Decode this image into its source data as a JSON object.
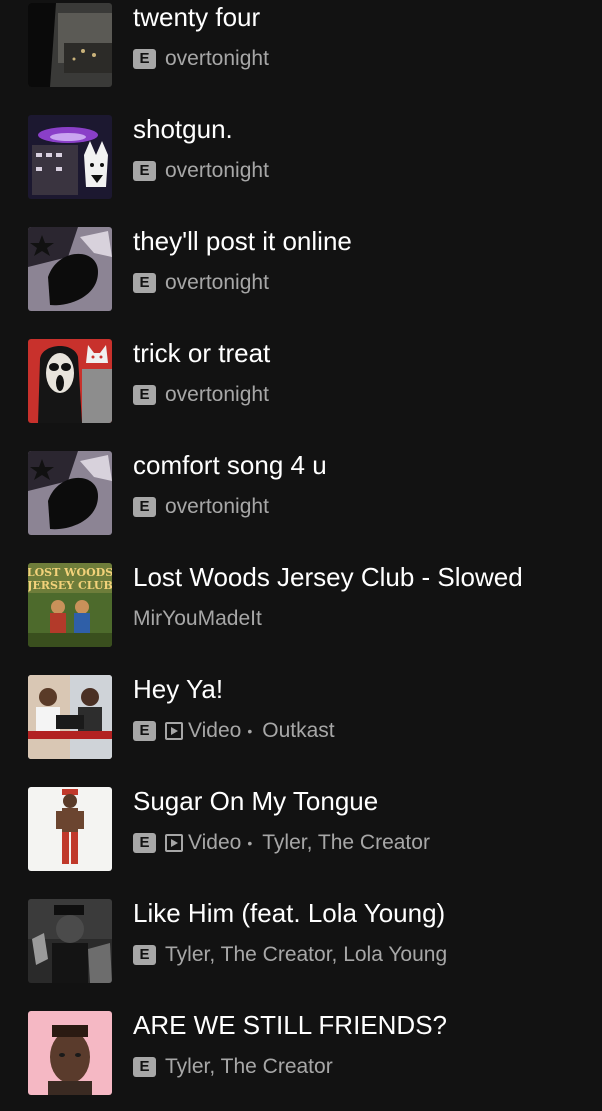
{
  "tracks": [
    {
      "title": "twenty four",
      "explicit_label": "E",
      "artist": "overtonight"
    },
    {
      "title": "shotgun.",
      "explicit_label": "E",
      "artist": "overtonight"
    },
    {
      "title": "they'll post it online",
      "explicit_label": "E",
      "artist": "overtonight"
    },
    {
      "title": "trick or treat",
      "explicit_label": "E",
      "artist": "overtonight"
    },
    {
      "title": "comfort song 4 u",
      "explicit_label": "E",
      "artist": "overtonight"
    },
    {
      "title": "Lost Woods Jersey Club - Slowed",
      "artist": "MirYouMadeIt",
      "art_text_line1": "LOST WOODS",
      "art_text_line2": "JERSEY CLUB"
    },
    {
      "title": "Hey Ya!",
      "explicit_label": "E",
      "type_label": "Video",
      "artist": "Outkast"
    },
    {
      "title": "Sugar On My Tongue",
      "explicit_label": "E",
      "type_label": "Video",
      "artist": "Tyler, The Creator"
    },
    {
      "title": "Like Him (feat. Lola Young)",
      "explicit_label": "E",
      "artist": "Tyler, The Creator, Lola Young"
    },
    {
      "title": "ARE WE STILL FRIENDS?",
      "explicit_label": "E",
      "artist": "Tyler, The Creator"
    }
  ],
  "colors": {
    "background": "#121212",
    "title": "#ffffff",
    "subtitle": "#a7a7a7"
  },
  "icons": {
    "explicit": "explicit-badge-icon",
    "video": "video-play-icon"
  }
}
